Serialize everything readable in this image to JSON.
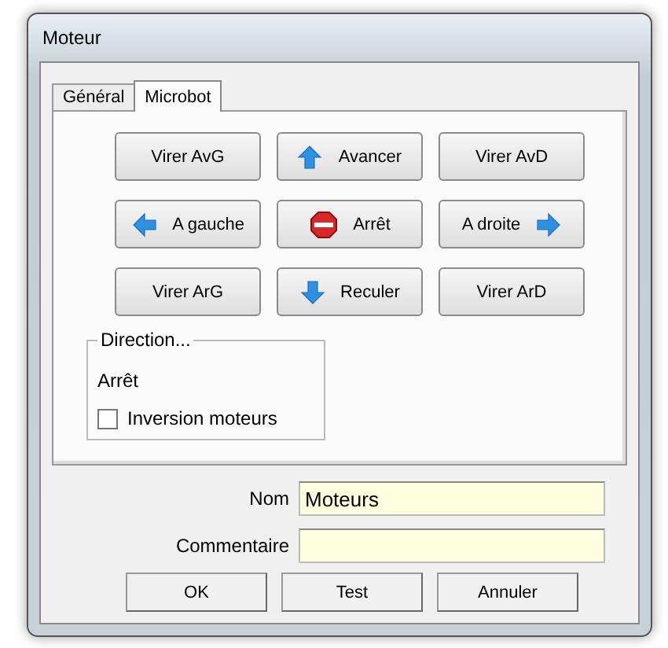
{
  "window": {
    "title": "Moteur"
  },
  "tabs": [
    {
      "label": "Général",
      "selected": false
    },
    {
      "label": "Microbot",
      "selected": true
    }
  ],
  "controls": [
    {
      "label": "Virer AvG",
      "kind": "plain"
    },
    {
      "label": "Avancer",
      "kind": "up"
    },
    {
      "label": "Virer AvD",
      "kind": "plain"
    },
    {
      "label": "A gauche",
      "kind": "left"
    },
    {
      "label": "Arrêt",
      "kind": "stop"
    },
    {
      "label": "A droite",
      "kind": "right"
    },
    {
      "label": "Virer ArG",
      "kind": "plain"
    },
    {
      "label": "Reculer",
      "kind": "down"
    },
    {
      "label": "Virer ArD",
      "kind": "plain"
    }
  ],
  "direction": {
    "title": "Direction...",
    "status": "Arrêt",
    "checkbox": {
      "label": "Inversion moteurs",
      "checked": false
    }
  },
  "form": [
    {
      "label": "Nom",
      "value": "Moteurs"
    },
    {
      "label": "Commentaire"
    }
  ],
  "buttons": [
    "OK",
    "Test",
    "Annuler"
  ]
}
